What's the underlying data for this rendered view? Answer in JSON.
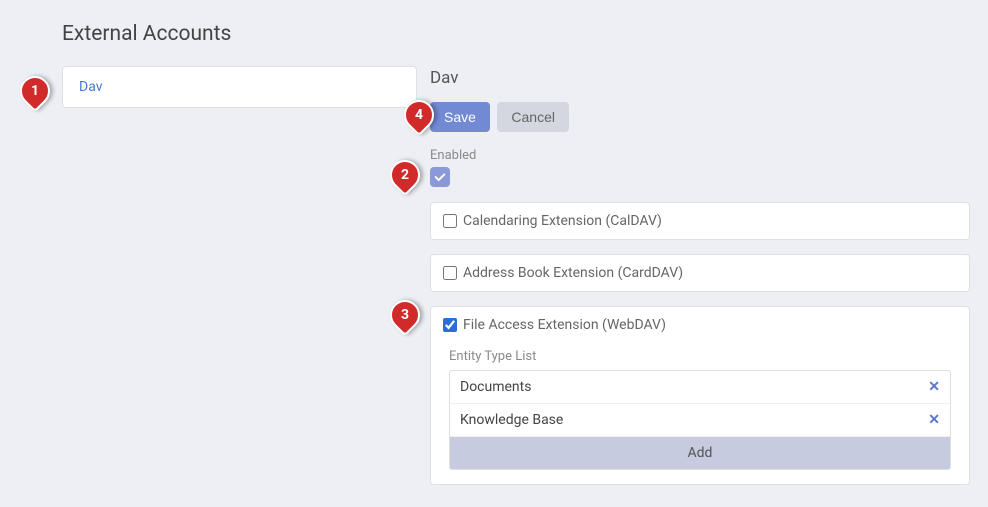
{
  "page_title": "External Accounts",
  "sidebar": {
    "items": [
      "Dav"
    ]
  },
  "panel": {
    "heading": "Dav",
    "save_label": "Save",
    "cancel_label": "Cancel",
    "enabled_label": "Enabled",
    "enabled_checked": true
  },
  "extensions": [
    {
      "label": "Calendaring Extension (CalDAV)",
      "checked": false
    },
    {
      "label": "Address Book Extension (CardDAV)",
      "checked": false
    },
    {
      "label": "File Access Extension (WebDAV)",
      "checked": true
    }
  ],
  "entity_type_list": {
    "label": "Entity Type List",
    "items": [
      "Documents",
      "Knowledge Base"
    ],
    "add_label": "Add"
  },
  "markers": {
    "1": "1",
    "2": "2",
    "3": "3",
    "4": "4"
  }
}
